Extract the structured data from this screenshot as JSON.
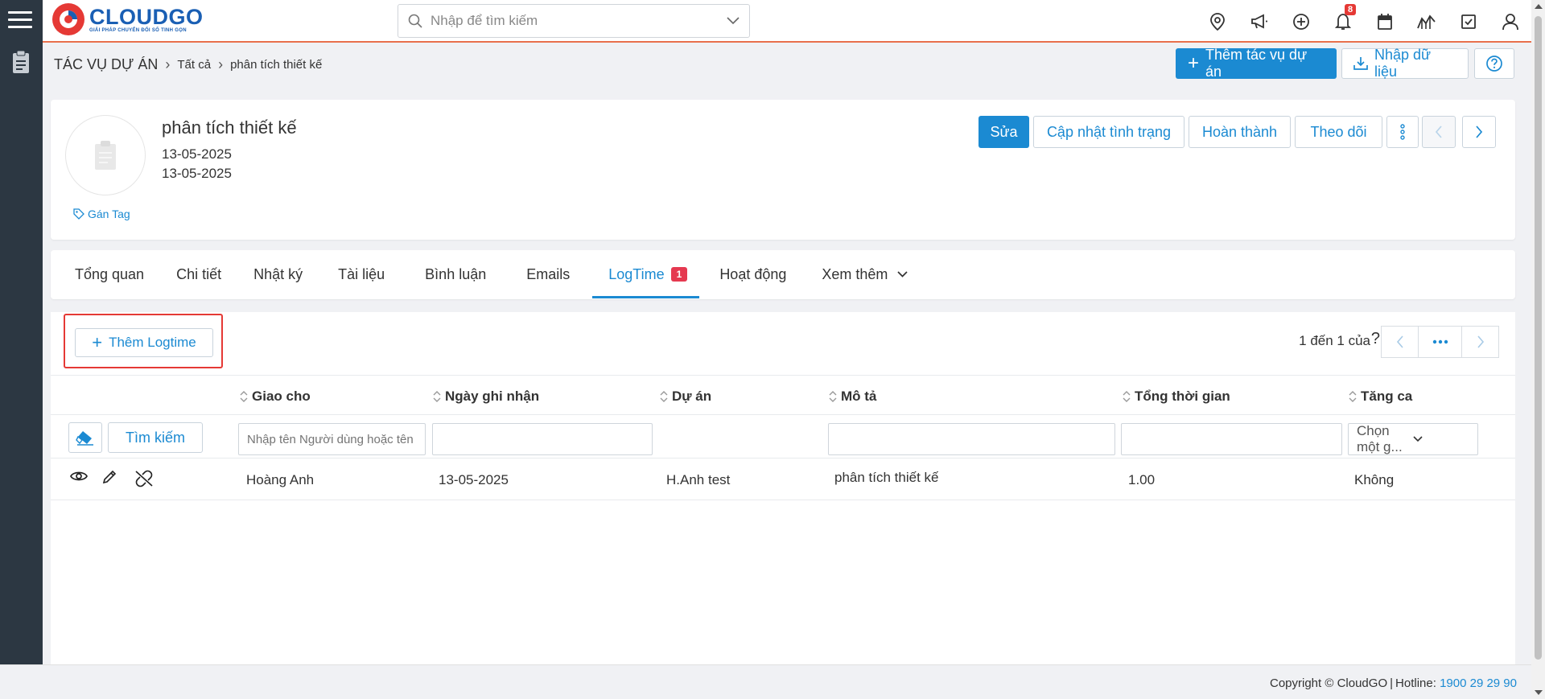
{
  "app": {
    "logo_text": "CLOUDGO",
    "logo_tagline": "GIẢI PHÁP CHUYỂN ĐỔI SỐ TINH GỌN",
    "search_placeholder": "Nhập để tìm kiếm",
    "notification_count": "8",
    "accent_color": "#1b8ad2",
    "brand_color": "#1a5fb4",
    "header_border_color": "#e8704c"
  },
  "breadcrumb": {
    "module": "TÁC VỤ DỰ ÁN",
    "filter": "Tất cả",
    "record": "phân tích thiết kế"
  },
  "header_actions": {
    "add_label": "Thêm tác vụ dự án",
    "import_label": "Nhập dữ liệu"
  },
  "record": {
    "title": "phân tích thiết kế",
    "date1": "13-05-2025",
    "date2": "13-05-2025",
    "tag_label": "Gán Tag",
    "edit_label": "Sửa",
    "update_status_label": "Cập nhật tình trạng",
    "complete_label": "Hoàn thành",
    "follow_label": "Theo dõi"
  },
  "tabs": {
    "overview": "Tổng quan",
    "detail": "Chi tiết",
    "log": "Nhật ký",
    "documents": "Tài liệu",
    "comments": "Bình luận",
    "emails": "Emails",
    "logtime": "LogTime",
    "logtime_count": "1",
    "activities": "Hoạt động",
    "more": "Xem thêm"
  },
  "logtime": {
    "add_label": "Thêm Logtime",
    "pager_text": "1 đến 1 của",
    "pager_help": "?",
    "columns": {
      "assigned": "Giao cho",
      "date": "Ngày ghi nhận",
      "project": "Dự án",
      "description": "Mô tả",
      "total_time": "Tổng thời gian",
      "overtime": "Tăng ca"
    },
    "filters": {
      "search_label": "Tìm kiếm",
      "assigned_placeholder": "Nhập tên Người dùng hoặc tên nhóm",
      "overtime_placeholder": "Chọn một g..."
    },
    "rows": [
      {
        "assigned": "Hoàng Anh",
        "date": "13-05-2025",
        "project": "H.Anh test",
        "description": "phân tích thiết kế",
        "total_time": "1.00",
        "overtime": "Không"
      }
    ]
  },
  "footer": {
    "copyright": "Copyright © CloudGO",
    "hotline_label": "Hotline:",
    "hotline_number": "1900 29 29 90"
  }
}
